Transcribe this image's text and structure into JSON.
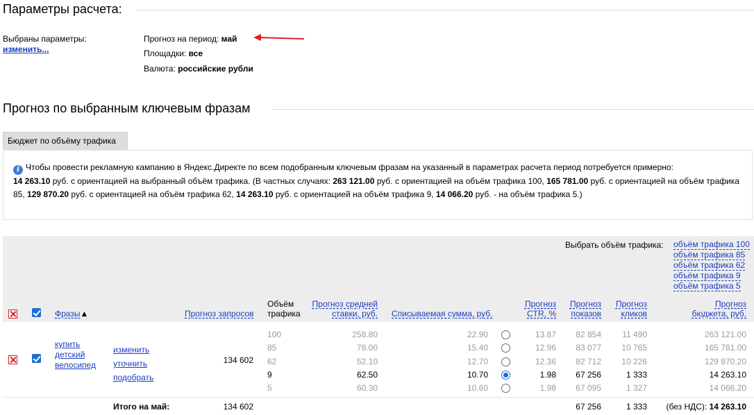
{
  "params": {
    "heading": "Параметры расчета:",
    "selected_label": "Выбраны параметры:",
    "change_link": "изменить...",
    "period_label": "Прогноз на период:",
    "period_value": "май",
    "platforms_label": "Площадки:",
    "platforms_value": "все",
    "currency_label": "Валюта:",
    "currency_value": "российские рубли"
  },
  "forecast": {
    "heading": "Прогноз по выбранным ключевым фразам",
    "tab_label": "Бюджет по объёму трафика",
    "info": {
      "t1": "Чтобы провести рекламную кампанию в Яндекс.Директе по всем подобранным ключевым фразам на указанный в параметрах расчета период потребуется примерно:",
      "b1": "14 263.10",
      "t2": " руб. с ориентацией на выбранный объём трафика. (В частных случаях: ",
      "b2": "263 121.00",
      "t3": " руб. с ориентацией на объём трафика 100, ",
      "b3": "165 781.00",
      "t4": " руб. с ориентацией на объём трафика 85, ",
      "b4": "129 870.20",
      "t5": " руб. с ориентацией на объём трафика 62, ",
      "b5": "14 263.10",
      "t6": " руб. с ориентацией на объём трафика 9, ",
      "b6": "14 066.20",
      "t7": " руб. - на объём трафика 5.)"
    }
  },
  "traffic_select": {
    "label": "Выбрать объём трафика:",
    "options": [
      "объём трафика 100",
      "объём трафика 85",
      "объём трафика 62",
      "объём трафика 9",
      "объём трафика 5"
    ]
  },
  "table": {
    "headers": {
      "phrases": "Фразы",
      "sort_arrow": "▲",
      "requests": "Прогноз запросов",
      "traffic_1": "Объём",
      "traffic_2": "трафика",
      "bid_1": "Прогноз средней",
      "bid_2": "ставки, руб.",
      "charge": "Списываемая сумма, руб.",
      "ctr_1": "Прогноз",
      "ctr_2": "CTR, %",
      "impr_1": "Прогноз",
      "impr_2": "показов",
      "clicks_1": "Прогноз",
      "clicks_2": "кликов",
      "budget_1": "Прогноз",
      "budget_2": "бюджета, руб."
    },
    "phrase": {
      "line1": "купить",
      "line2": "детский",
      "line3": "велосипед",
      "action_edit": "изменить",
      "action_refine": "уточнить",
      "action_pick": "подобрать",
      "requests": "134 602"
    },
    "rows": [
      {
        "traffic": "100",
        "bid": "258.80",
        "charge": "22.90",
        "ctr": "13.87",
        "impr": "82 854",
        "clicks": "11 490",
        "budget": "263 121.00",
        "selected": false
      },
      {
        "traffic": "85",
        "bid": "78.00",
        "charge": "15.40",
        "ctr": "12.96",
        "impr": "83 077",
        "clicks": "10 765",
        "budget": "165 781.00",
        "selected": false
      },
      {
        "traffic": "62",
        "bid": "52.10",
        "charge": "12.70",
        "ctr": "12.36",
        "impr": "82 712",
        "clicks": "10 226",
        "budget": "129 870.20",
        "selected": false
      },
      {
        "traffic": "9",
        "bid": "62.50",
        "charge": "10.70",
        "ctr": "1.98",
        "impr": "67 256",
        "clicks": "1 333",
        "budget": "14 263.10",
        "selected": true
      },
      {
        "traffic": "5",
        "bid": "60.30",
        "charge": "10.60",
        "ctr": "1.98",
        "impr": "67 095",
        "clicks": "1 327",
        "budget": "14 066.20",
        "selected": false
      }
    ],
    "total": {
      "label": "Итого на май:",
      "requests": "134 602",
      "impr": "67 256",
      "clicks": "1 333",
      "budget_prefix": "(без НДС):",
      "budget": "14 263.10"
    }
  },
  "colors": {
    "link": "#1a3dc1",
    "checkbox": "#1a6fd8",
    "delete": "#cc2222",
    "arrow": "#e02020"
  }
}
